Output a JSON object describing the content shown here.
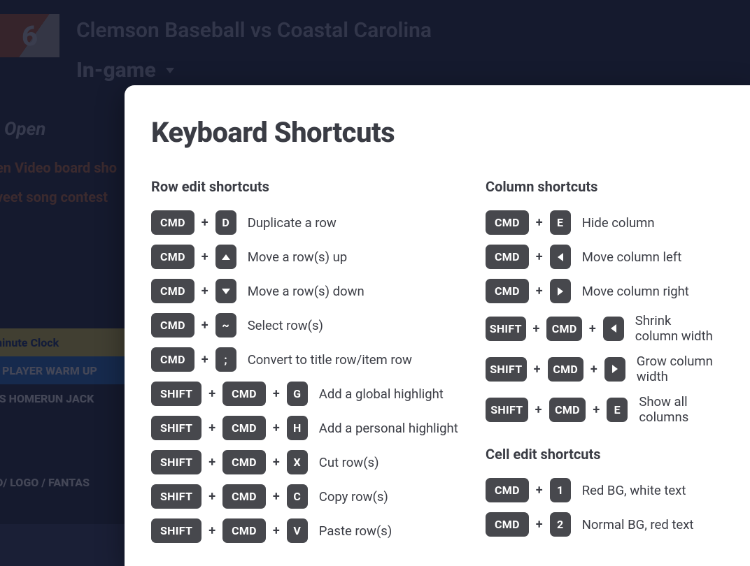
{
  "background": {
    "logo_text": "6",
    "game_title": "Clemson Baseball vs Coastal Carolina",
    "mode_label": "In-game",
    "open_label": "Open",
    "links": [
      "en Video board sho",
      "veet song contest"
    ],
    "rows": [
      {
        "style": "yellow",
        "text": "ninute Clock"
      },
      {
        "style": "blue",
        "text": "· PLAYER WARM UP"
      },
      {
        "style": "dark",
        "text": "IS HOMERUN JACK"
      },
      {
        "style": "dark",
        "text": ""
      },
      {
        "style": "dark",
        "text": ""
      },
      {
        "style": "dark",
        "text": "D/ LOGO / FANTAS"
      }
    ]
  },
  "modal": {
    "title": "Keyboard Shortcuts",
    "sections": {
      "row_edit": {
        "title": "Row edit shortcuts",
        "items": [
          {
            "keys": [
              "CMD",
              "D"
            ],
            "desc": "Duplicate a row"
          },
          {
            "keys": [
              "CMD",
              "icon:up"
            ],
            "desc": "Move a row(s) up"
          },
          {
            "keys": [
              "CMD",
              "icon:down"
            ],
            "desc": "Move a row(s) down"
          },
          {
            "keys": [
              "CMD",
              "~"
            ],
            "desc": "Select row(s)"
          },
          {
            "keys": [
              "CMD",
              ";"
            ],
            "desc": "Convert to title row/item row"
          },
          {
            "keys": [
              "SHIFT",
              "CMD",
              "G"
            ],
            "desc": "Add a global highlight"
          },
          {
            "keys": [
              "SHIFT",
              "CMD",
              "H"
            ],
            "desc": "Add a personal highlight"
          },
          {
            "keys": [
              "SHIFT",
              "CMD",
              "X"
            ],
            "desc": "Cut row(s)"
          },
          {
            "keys": [
              "SHIFT",
              "CMD",
              "C"
            ],
            "desc": "Copy row(s)"
          },
          {
            "keys": [
              "SHIFT",
              "CMD",
              "V"
            ],
            "desc": "Paste row(s)"
          }
        ]
      },
      "column": {
        "title": "Column shortcuts",
        "items": [
          {
            "keys": [
              "CMD",
              "E"
            ],
            "desc": "Hide column"
          },
          {
            "keys": [
              "CMD",
              "icon:left"
            ],
            "desc": "Move column left"
          },
          {
            "keys": [
              "CMD",
              "icon:right"
            ],
            "desc": "Move column right"
          },
          {
            "keys": [
              "SHIFT",
              "CMD",
              "icon:left"
            ],
            "desc": "Shrink column width"
          },
          {
            "keys": [
              "SHIFT",
              "CMD",
              "icon:right"
            ],
            "desc": "Grow column width"
          },
          {
            "keys": [
              "SHIFT",
              "CMD",
              "E"
            ],
            "desc": "Show all columns"
          }
        ]
      },
      "cell_edit": {
        "title": "Cell edit shortcuts",
        "items": [
          {
            "keys": [
              "CMD",
              "1"
            ],
            "desc": "Red BG, white text"
          },
          {
            "keys": [
              "CMD",
              "2"
            ],
            "desc": "Normal BG, red text"
          }
        ]
      }
    }
  }
}
